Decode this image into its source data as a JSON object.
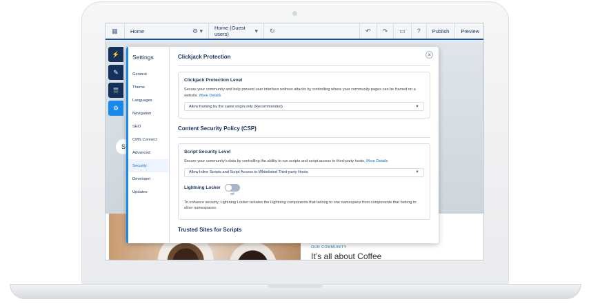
{
  "topbar": {
    "home": "Home",
    "page_selector": "Home (Guest users)",
    "publish": "Publish",
    "preview": "Preview"
  },
  "promo": {
    "kicker": "OUR COMMUNITY",
    "title": "It’s all about Coffee"
  },
  "canvas": {
    "blob_letter": "S"
  },
  "settings": {
    "title": "Settings",
    "nav": [
      "General",
      "Theme",
      "Languages",
      "Navigation",
      "SEO",
      "CMS Connect",
      "Advanced",
      "Security",
      "Developer",
      "Updates"
    ],
    "selected": "Security"
  },
  "clickjack": {
    "section_title": "Clickjack Protection",
    "card_title": "Clickjack Protection Level",
    "description": "Secure your community and help prevent user interface redress attacks by controlling where your community pages can be framed on a website.",
    "more_details": "More Details",
    "select_value": "Allow framing by the same origin only (Recommended)"
  },
  "csp": {
    "section_title": "Content Security Policy (CSP)",
    "card_title": "Script Security Level",
    "description": "Secure your community's data by controlling the ability to run scripts and script access to third-party hosts.",
    "more_details": "More Details",
    "select_value": "Allow Inline Scripts and Script Access to Whitelisted Third-party Hosts",
    "locker_label": "Lightning Locker",
    "locker_state": "Off",
    "locker_description": "To enhance security, Lightning Locker isolates the Lightning components that belong to one namespace from components that belong to other namespaces."
  },
  "trusted": {
    "section_title": "Trusted Sites for Scripts"
  }
}
